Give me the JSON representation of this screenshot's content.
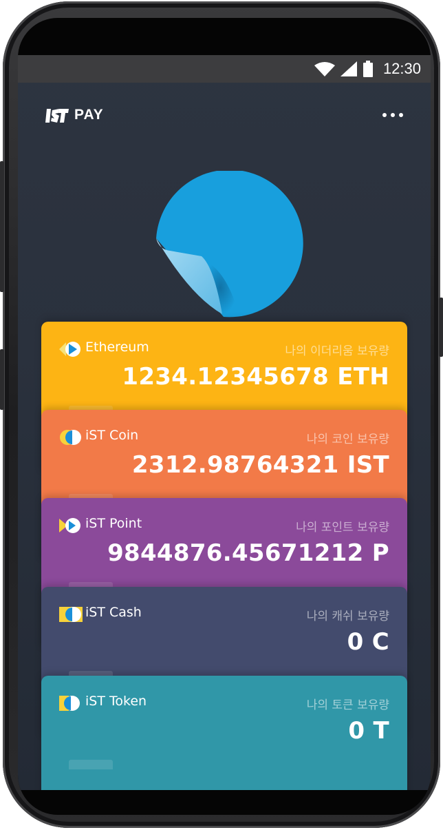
{
  "status_bar": {
    "time": "12:30",
    "icons": [
      "wifi-icon",
      "signal-icon",
      "battery-icon"
    ]
  },
  "app_bar": {
    "logo_text": "PAY",
    "menu_icon": "more-horizontal-icon"
  },
  "colors": {
    "sticker": "#189fdd",
    "ethereum": "#fdb414",
    "ist_coin": "#f27a48",
    "ist_point": "#8b4a9a",
    "ist_cash": "#434b6d",
    "ist_token": "#3097a8"
  },
  "cards": [
    {
      "name": "Ethereum",
      "label": "나의 이더리움 보유량",
      "amount": "1234.12345678 ETH"
    },
    {
      "name": "iST Coin",
      "label": "나의 코인 보유량",
      "amount": "2312.98764321 IST"
    },
    {
      "name": "iST Point",
      "label": "나의 포인트 보유량",
      "amount": "9844876.45671212 P"
    },
    {
      "name": "iST Cash",
      "label": "나의 캐쉬 보유량",
      "amount": "0 C"
    },
    {
      "name": "iST Token",
      "label": "나의 토큰 보유량",
      "amount": "0 T"
    }
  ]
}
